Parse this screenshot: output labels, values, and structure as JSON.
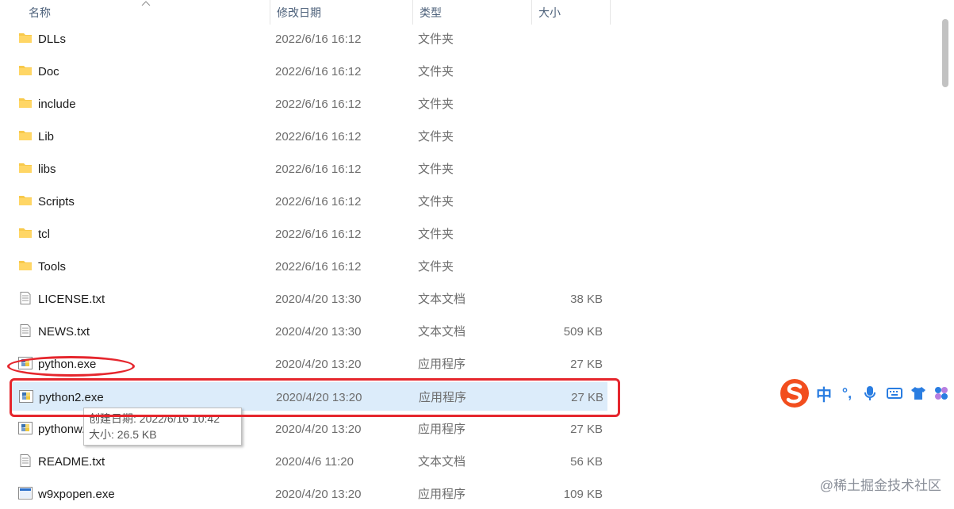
{
  "headers": {
    "name": "名称",
    "date": "修改日期",
    "type": "类型",
    "size": "大小"
  },
  "files": [
    {
      "name": "DLLs",
      "date": "2022/6/16 16:12",
      "type": "文件夹",
      "size": "",
      "icon": "folder-icon"
    },
    {
      "name": "Doc",
      "date": "2022/6/16 16:12",
      "type": "文件夹",
      "size": "",
      "icon": "folder-icon"
    },
    {
      "name": "include",
      "date": "2022/6/16 16:12",
      "type": "文件夹",
      "size": "",
      "icon": "folder-icon"
    },
    {
      "name": "Lib",
      "date": "2022/6/16 16:12",
      "type": "文件夹",
      "size": "",
      "icon": "folder-icon"
    },
    {
      "name": "libs",
      "date": "2022/6/16 16:12",
      "type": "文件夹",
      "size": "",
      "icon": "folder-icon"
    },
    {
      "name": "Scripts",
      "date": "2022/6/16 16:12",
      "type": "文件夹",
      "size": "",
      "icon": "folder-icon"
    },
    {
      "name": "tcl",
      "date": "2022/6/16 16:12",
      "type": "文件夹",
      "size": "",
      "icon": "folder-icon"
    },
    {
      "name": "Tools",
      "date": "2022/6/16 16:12",
      "type": "文件夹",
      "size": "",
      "icon": "folder-icon"
    },
    {
      "name": "LICENSE.txt",
      "date": "2020/4/20 13:30",
      "type": "文本文档",
      "size": "38 KB",
      "icon": "text-file-icon"
    },
    {
      "name": "NEWS.txt",
      "date": "2020/4/20 13:30",
      "type": "文本文档",
      "size": "509 KB",
      "icon": "text-file-icon"
    },
    {
      "name": "python.exe",
      "date": "2020/4/20 13:20",
      "type": "应用程序",
      "size": "27 KB",
      "icon": "python-icon"
    },
    {
      "name": "python2.exe",
      "date": "2020/4/20 13:20",
      "type": "应用程序",
      "size": "27 KB",
      "icon": "python-icon"
    },
    {
      "name": "pythonw.exe",
      "date": "2020/4/20 13:20",
      "type": "应用程序",
      "size": "27 KB",
      "icon": "python-icon"
    },
    {
      "name": "README.txt",
      "date": "2020/4/6 11:20",
      "type": "文本文档",
      "size": "56 KB",
      "icon": "text-file-icon"
    },
    {
      "name": "w9xpopen.exe",
      "date": "2020/4/20 13:20",
      "type": "应用程序",
      "size": "109 KB",
      "icon": "window-app-icon"
    }
  ],
  "selected_index": 11,
  "tooltip": {
    "created": "创建日期: 2022/6/16 10:42",
    "size": "大小: 26.5 KB"
  },
  "ime": {
    "mode": "中",
    "punct": "°,"
  },
  "watermark": "@稀土掘金技术社区",
  "colors": {
    "annotation": "#e5262d",
    "selection": "#dcecfa",
    "folder": "#f8c94b",
    "ime_logo": "#f24e1e"
  }
}
